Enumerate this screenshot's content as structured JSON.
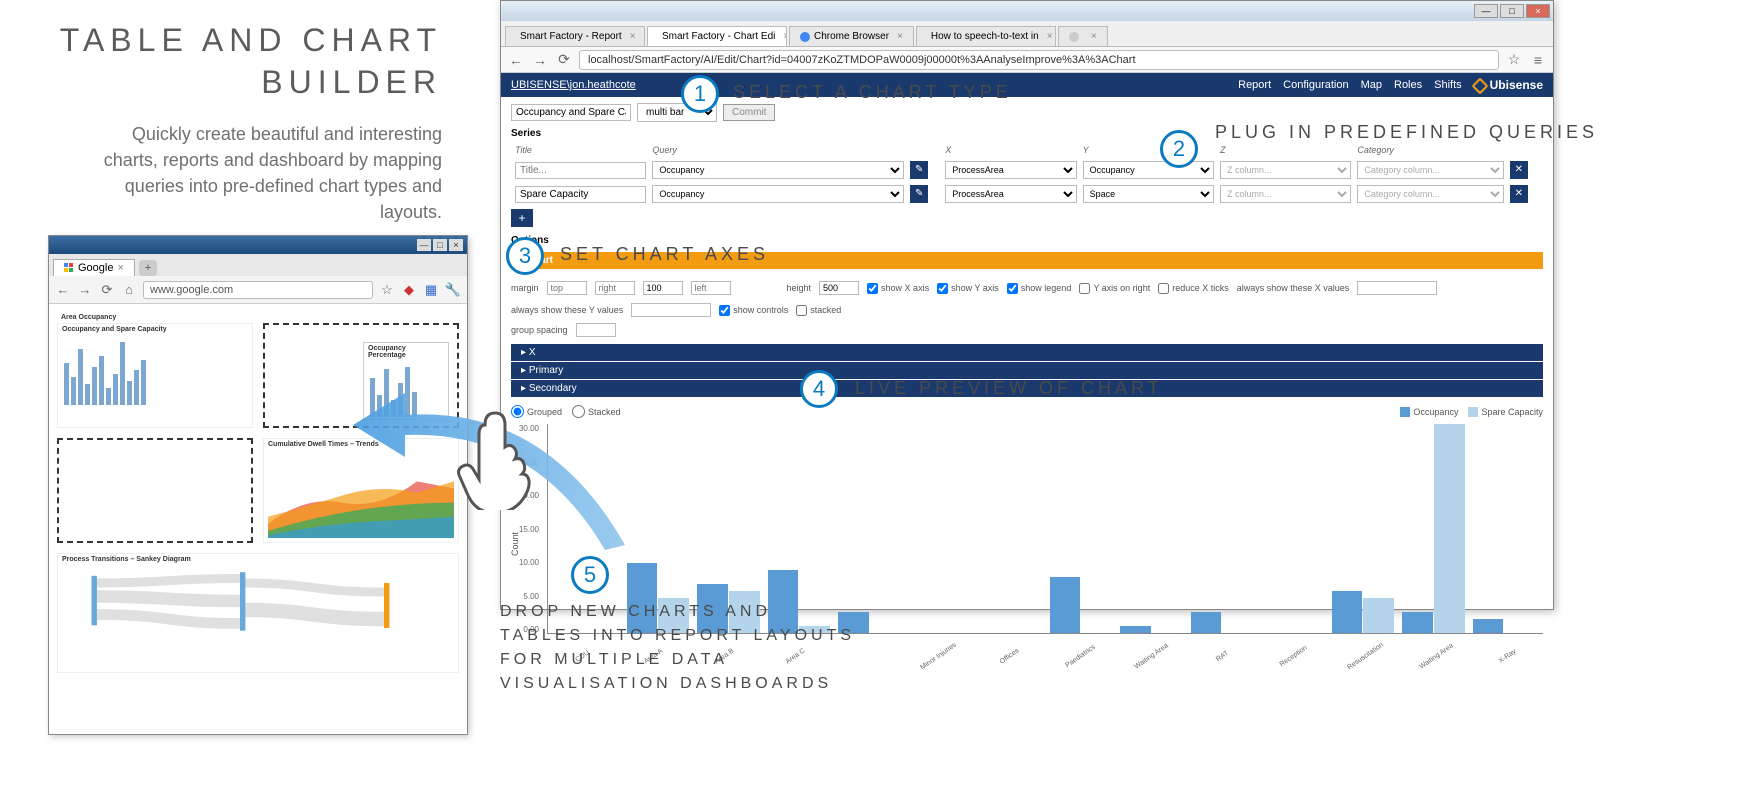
{
  "left": {
    "title": "TABLE AND CHART BUILDER",
    "desc": "Quickly create beautiful and interesting charts, reports and dashboard by mapping queries into pre-defined chart types and layouts."
  },
  "miniBrowser": {
    "tab": "Google",
    "url": "www.google.com",
    "areaTitle": "Area Occupancy",
    "sub1": "Occupancy and Spare Capacity",
    "sub2": "Occupancy Percentage",
    "trendTitle": "Cumulative Dwell Times – Trends",
    "sankeyTitle": "Process Transitions – Sankey Diagram"
  },
  "browserTabs": [
    {
      "label": "Smart Factory - Report",
      "fav": "#d9534f"
    },
    {
      "label": "Smart Factory - Chart Edi",
      "fav": "#d9534f",
      "active": true
    },
    {
      "label": "Chrome Browser",
      "fav": "#4285f4"
    },
    {
      "label": "How to speech-to-text in",
      "fav": "#5bc0de"
    },
    {
      "label": "",
      "fav": "#ccc"
    }
  ],
  "addressBar": "localhost/SmartFactory/AI/Edit/Chart?id=04007zKoZTMDOPaW0009j00000t%3AAnalyseImprove%3A%3AChart",
  "appBar": {
    "user": "UBISENSE\\jon.heathcote",
    "nav": [
      "Report",
      "Configuration",
      "Map",
      "Roles",
      "Shifts"
    ],
    "brand": "Ubisense"
  },
  "cfg": {
    "name": "Occupancy and Spare Ca",
    "chartType": "multi bar",
    "commit": "Commit"
  },
  "seriesHeader": "Series",
  "seriesCols": {
    "title": "Title",
    "query": "Query",
    "x": "X",
    "y": "Y",
    "z": "Z",
    "cat": "Category"
  },
  "series": [
    {
      "title": "",
      "titlePh": "Title...",
      "query": "Occupancy",
      "x": "ProcessArea",
      "y": "Occupancy",
      "z": "Z column...",
      "cat": "Category column..."
    },
    {
      "title": "Spare Capacity",
      "titlePh": "",
      "query": "Occupancy",
      "x": "ProcessArea",
      "y": "Space",
      "z": "Z column...",
      "cat": "Category column..."
    }
  ],
  "optionsHeader": "Options",
  "optChart": "Chart",
  "axes": {
    "marginLabel": "margin",
    "top": "",
    "right": "",
    "bottom": "100",
    "left": "",
    "groupSpacing": "group spacing",
    "groupSpacingVal": "",
    "heightLabel": "height",
    "height": "500",
    "showX": "show X axis",
    "showY": "show Y axis",
    "showLegend": "show legend",
    "yRight": "Y axis on right",
    "reduceX": "reduce X ticks",
    "alwaysX": "always show these X values",
    "alwaysXVal": "",
    "alwaysY": "always show these Y values",
    "alwaysYVal": "",
    "showControls": "show controls",
    "stacked": "stacked"
  },
  "accordion": [
    "X",
    "Primary",
    "Secondary"
  ],
  "preview": {
    "grouped": "Grouped",
    "stacked": "Stacked",
    "leg1": "Occupancy",
    "leg2": "Spare Capacity",
    "ylabel": "Count"
  },
  "callouts": {
    "c1": "SELECT A CHART TYPE",
    "c2": "PLUG IN PREDEFINED QUERIES",
    "c3": "SET CHART AXES",
    "c4": "LIVE PREVIEW OF CHART",
    "c5": "DROP NEW CHARTS AND TABLES INTO REPORT LAYOUTS FOR MULTIPLE DATA VISUALISATION DASHBOARDS"
  },
  "chart_data": {
    "type": "bar",
    "title": "",
    "xlabel": "",
    "ylabel": "Count",
    "ylim": [
      0,
      30
    ],
    "categories": [
      "CDU",
      "Area A",
      "Area B",
      "Area C",
      "",
      "Minor Injuries",
      "Offices",
      "Paediatrics",
      "Waiting Area",
      "RAT",
      "Reception",
      "Resuscitation",
      "Waiting Area",
      "X-Ray"
    ],
    "series": [
      {
        "name": "Occupancy",
        "color": "#5b9bd5",
        "values": [
          0,
          10,
          7,
          9,
          3,
          0,
          0,
          8,
          1,
          3,
          0,
          6,
          3,
          2
        ]
      },
      {
        "name": "Spare Capacity",
        "color": "#b4d4ec",
        "values": [
          0,
          5,
          6,
          1,
          0,
          0,
          0,
          0,
          0,
          0,
          0,
          5,
          30,
          0
        ]
      }
    ]
  }
}
